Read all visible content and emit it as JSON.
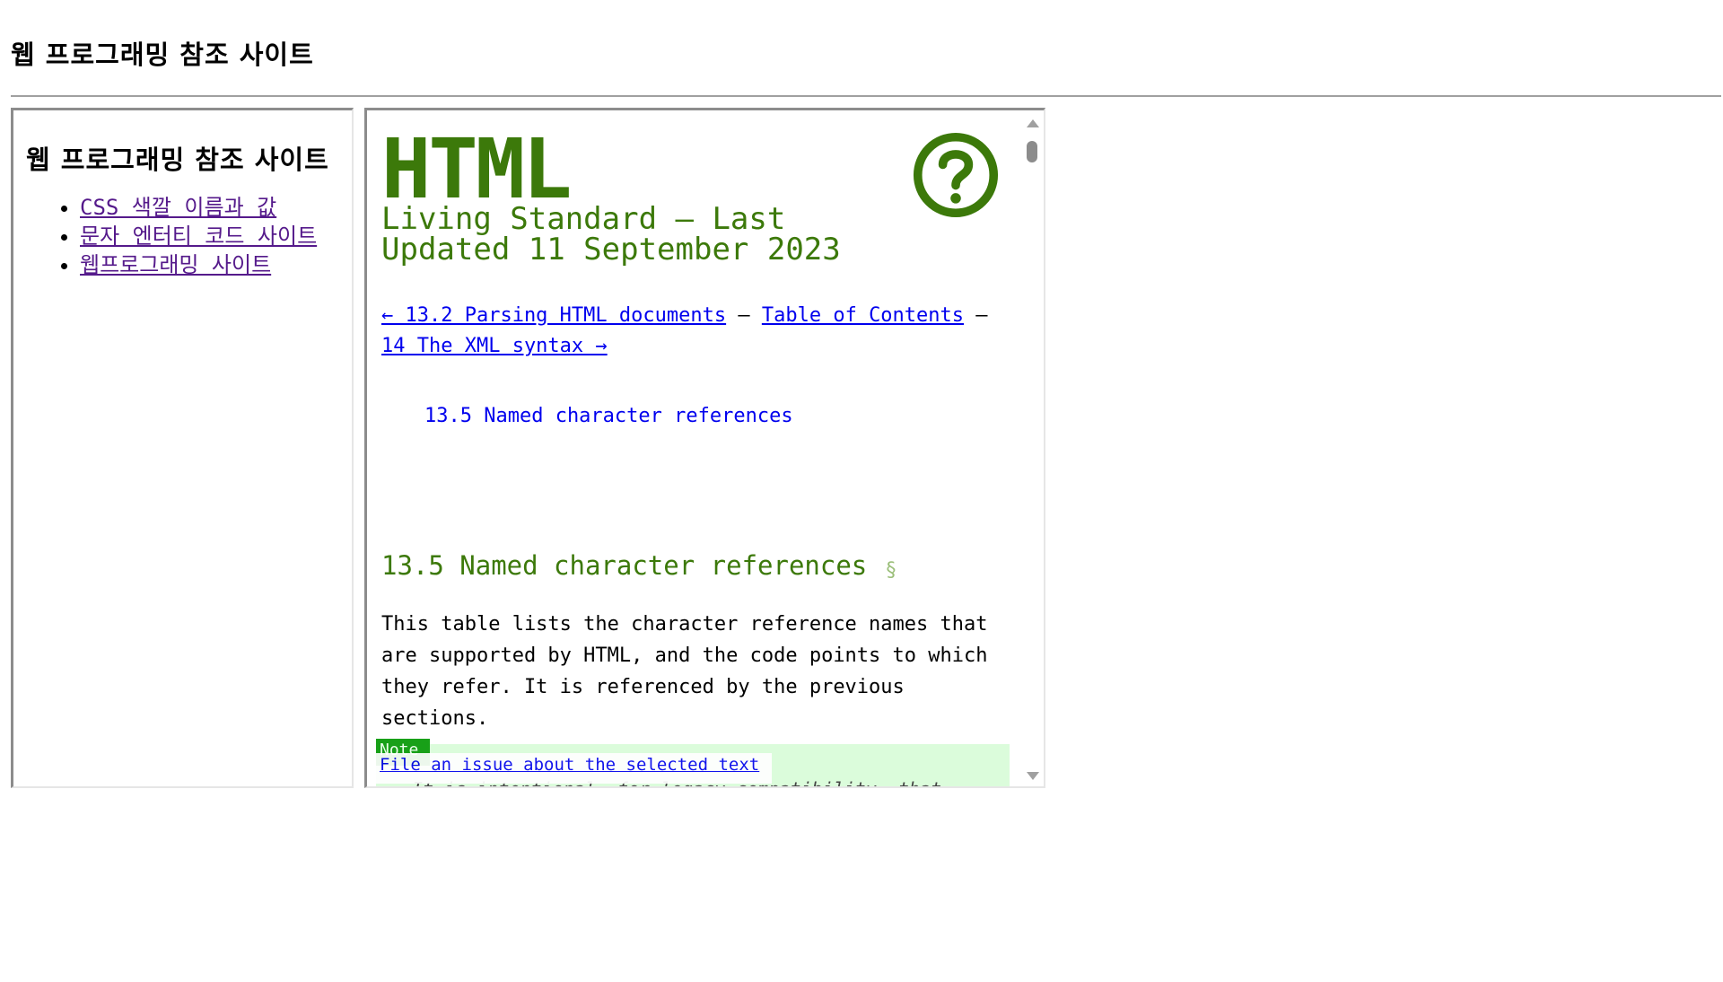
{
  "page": {
    "title": "웹 프로그래밍 참조 사이트"
  },
  "sidebar": {
    "title": "웹 프로그래밍 참조 사이트",
    "links": [
      {
        "label": "CSS 색깔 이름과 값"
      },
      {
        "label": "문자 엔터티 코드 사이트"
      },
      {
        "label": "웹프로그래밍 사이트"
      }
    ]
  },
  "content": {
    "logo_text": "HTML",
    "subtitle": "Living Standard — Last Updated 11 September 2023",
    "nav": {
      "prev": "← 13.2 Parsing HTML documents",
      "sep1": " — ",
      "toc": "Table of Contents",
      "sep2": " — ",
      "next": "14 The XML syntax →"
    },
    "toc_item": "13.5 Named character references",
    "section": {
      "heading": "13.5 Named character references",
      "self_link": "§",
      "paragraph": "This table lists the character reference names that are supported by HTML, and the code points to which they refer. It is referenced by the previous sections."
    },
    "note": {
      "label": "Note",
      "text": "It is intentional, for legacy compatibility, that"
    },
    "issue_popup": "File an issue about the selected text",
    "help_icon": "question-circle-icon"
  },
  "colors": {
    "heading_green": "#3c790a",
    "link_blue": "#0000ee",
    "visited_purple": "#551a8b",
    "note_bg": "#dbfcdb"
  }
}
